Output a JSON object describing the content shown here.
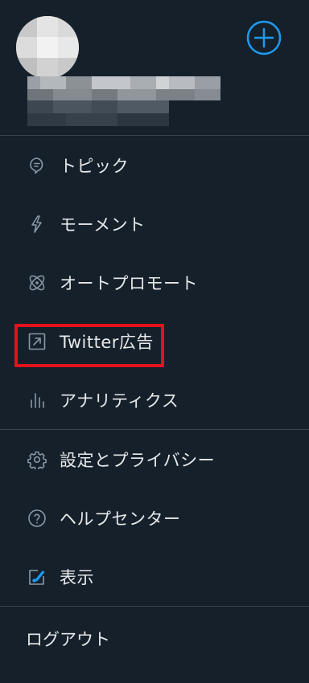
{
  "profile": {
    "add_account_icon": "plus-circle-icon"
  },
  "menu_group_1": [
    {
      "label": "トピック",
      "icon": "topic-icon"
    },
    {
      "label": "モーメント",
      "icon": "lightning-icon"
    },
    {
      "label": "オートプロモート",
      "icon": "atom-icon"
    },
    {
      "label": "Twitter広告",
      "icon": "external-link-icon"
    },
    {
      "label": "アナリティクス",
      "icon": "bar-chart-icon"
    }
  ],
  "menu_group_2": [
    {
      "label": "設定とプライバシー",
      "icon": "gear-icon"
    },
    {
      "label": "ヘルプセンター",
      "icon": "question-icon"
    },
    {
      "label": "表示",
      "icon": "edit-display-icon"
    }
  ],
  "logout_label": "ログアウト",
  "colors": {
    "background": "#15202b",
    "divider": "#38444d",
    "accent": "#1d9bf0",
    "highlight": "#e3121c"
  }
}
